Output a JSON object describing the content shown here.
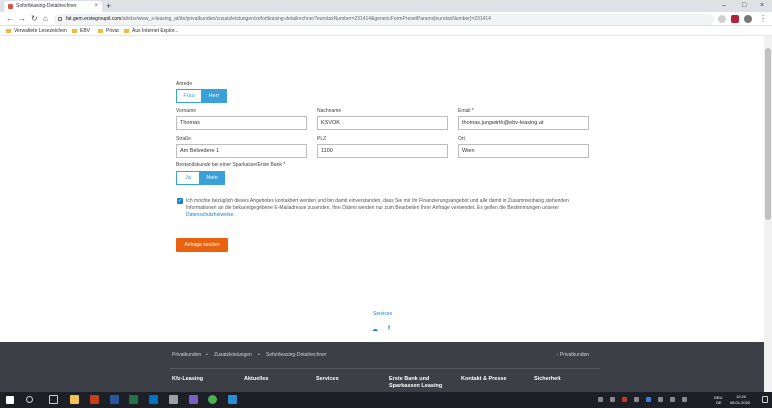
{
  "browser": {
    "tab_title": "Sofortleasing-Detailrechner",
    "tab_close": "×",
    "new_tab": "+",
    "url_host": "fat.gem.erstegroupit.com",
    "url_path": "/at/ebv/www_s-leasing_at/de/privatkunden/zusatzleistungen/sofortleasing-detailrechner?eurotaxNumber=231414&genericFormPresetParams[eurotaxNumber]=231414",
    "bookmarks": [
      "Verwaltete Lesezeichen",
      "EBV",
      "Privat",
      "Aus Internet Explor..."
    ],
    "window_controls": [
      "–",
      "□",
      "×"
    ],
    "nav": [
      "←",
      "→",
      "↻",
      "⌂"
    ]
  },
  "form": {
    "anrede_label": "Anrede",
    "anrede_options": [
      "Frau",
      "Herr"
    ],
    "anrede_selected": "Herr",
    "vorname_label": "Vorname",
    "vorname_value": "Thomas",
    "nachname_label": "Nachname",
    "nachname_value": "KSVOK",
    "email_label": "Email",
    "email_required": "*",
    "email_value": "thomas.jungwirth@ebv-leasing.at",
    "strasse_label": "Straße",
    "strasse_value": "Am Belvedere 1",
    "plz_label": "PLZ",
    "plz_value": "1100",
    "ort_label": "Ort",
    "ort_value": "Wien",
    "bestandskunde_label": "Bestandskunde bei einer Sparkasse/Erste Bank",
    "bestandskunde_required": "*",
    "bestandskunde_options": [
      "Ja",
      "Nein"
    ],
    "bestandskunde_selected": "Nein",
    "consent_text": "Ich möchte bezüglich dieses Angebotes kontaktiert werden und bin damit einverstanden, dass Sie mir Ihr Finanzierungsangebot und alle damit in Zusammenhang stehenden Informationen an die bekanntgegebene E-Mailadresse zusenden. Ihre Dateni werden nur zum Bearbeiten Ihrer Anfrage verwendet. Es gelten die Bestimmungen unserer",
    "consent_link": "Datenschutzhinweise",
    "consent_end": ".",
    "submit_label": "Anfrage senden",
    "checkmark": "✓"
  },
  "services": {
    "label": "Services",
    "social_icons": [
      "cloud-icon",
      "facebook-icon"
    ],
    "cloud_glyph": "☁",
    "facebook_glyph": "f"
  },
  "footer": {
    "breadcrumb": [
      "Privatkunden",
      "Zusatzleistungen",
      "Sofortleasing-Detailrechner"
    ],
    "separator": "•",
    "top_link": "↑ Privatkunden",
    "nav": [
      "Kfz-Leasing",
      "Aktuelles",
      "Services",
      "Erste Bank und Sparkassen Leasing",
      "Kontakt & Presse",
      "Sicherheit"
    ]
  },
  "taskbar": {
    "lang": "DEU",
    "lang_sub": "DE",
    "time": "12:20",
    "date": "08.01.2020"
  },
  "colors": {
    "primary_blue": "#3aa0d8",
    "link_blue": "#1d82c9",
    "submit_orange": "#e8620f",
    "footer_bg": "#3c4046"
  }
}
